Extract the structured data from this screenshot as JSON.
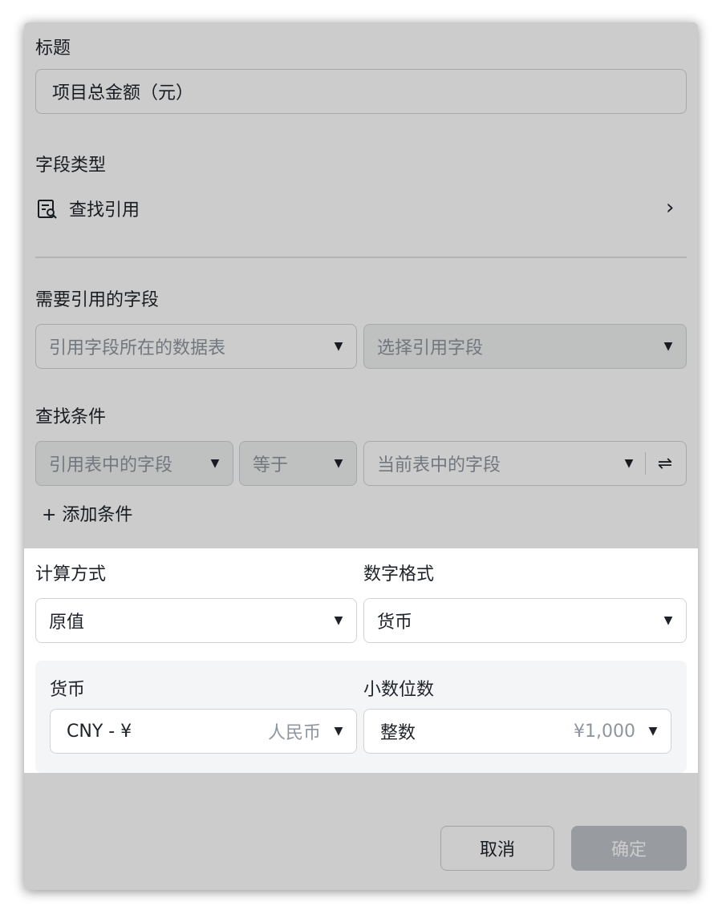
{
  "title_section": {
    "label": "标题",
    "value": "项目总金额（元）"
  },
  "field_type": {
    "label": "字段类型",
    "value": "查找引用",
    "icon": "lookup-table-icon"
  },
  "ref_field": {
    "label": "需要引用的字段",
    "table_select": "引用字段所在的数据表",
    "field_select": "选择引用字段"
  },
  "condition": {
    "label": "查找条件",
    "ref_field_select": "引用表中的字段",
    "operator_select": "等于",
    "current_field_select": "当前表中的字段",
    "add_label": "+ 添加条件"
  },
  "calc": {
    "label": "计算方式",
    "value": "原值"
  },
  "number_format": {
    "label": "数字格式",
    "value": "货币"
  },
  "currency": {
    "label": "货币",
    "value": "CNY - ¥",
    "hint": "人民币"
  },
  "decimals": {
    "label": "小数位数",
    "value": "整数",
    "hint": "¥1,000"
  },
  "footer": {
    "cancel": "取消",
    "ok": "确定"
  }
}
